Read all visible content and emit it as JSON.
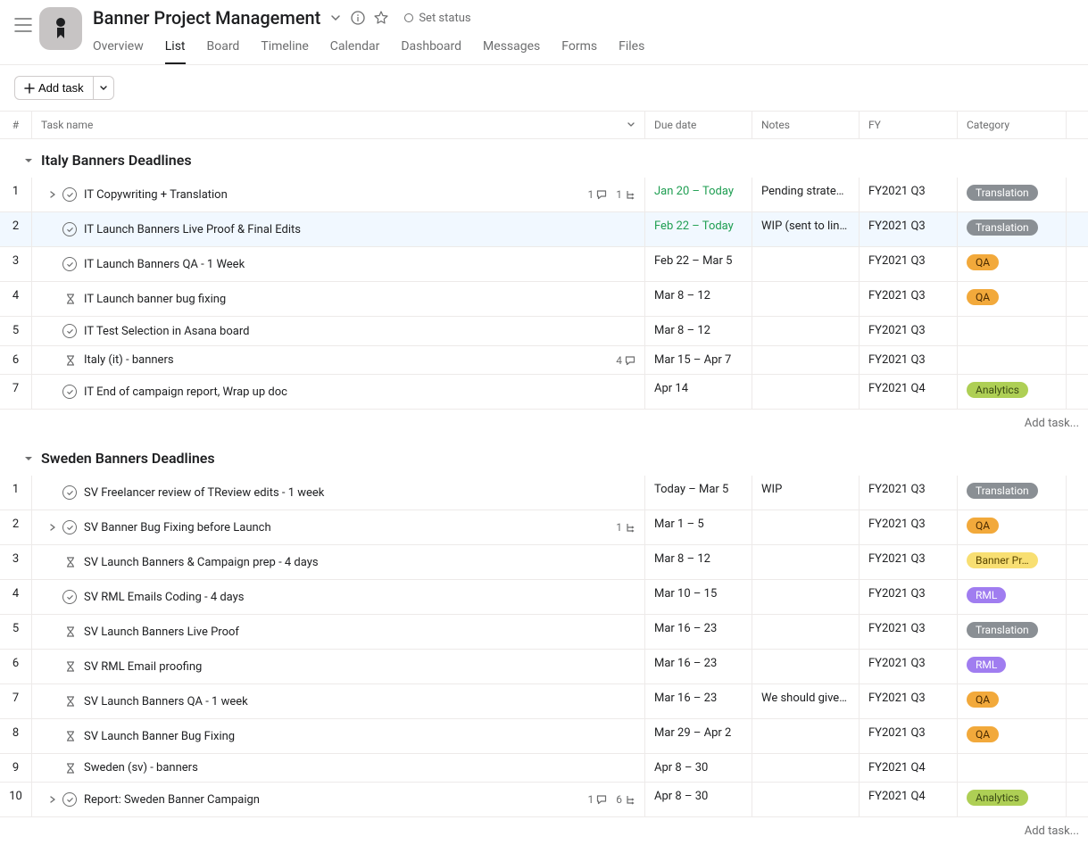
{
  "header": {
    "title": "Banner Project Management",
    "status_label": "Set status"
  },
  "tabs": [
    "Overview",
    "List",
    "Board",
    "Timeline",
    "Calendar",
    "Dashboard",
    "Messages",
    "Forms",
    "Files"
  ],
  "active_tab": "List",
  "toolbar": {
    "add_task": "Add task"
  },
  "columns": {
    "num": "#",
    "task": "Task name",
    "due": "Due date",
    "notes": "Notes",
    "fy": "FY",
    "category": "Category"
  },
  "add_task_placeholder": "Add task...",
  "sections": [
    {
      "title": "Italy Banners Deadlines",
      "rows": [
        {
          "n": 1,
          "icon": "check",
          "children": true,
          "name": "IT Copywriting + Translation",
          "comments": 1,
          "subtasks": 1,
          "due": "Jan 20 – Today",
          "due_color": "green",
          "notes": "Pending strategy …",
          "fy": "FY2021 Q3",
          "cat": "Translation",
          "cat_class": "translation"
        },
        {
          "n": 2,
          "icon": "check",
          "name": "IT Launch Banners Live Proof & Final Edits",
          "due": "Feb 22 – Today",
          "due_color": "green",
          "notes": "WIP (sent to lingu…",
          "fy": "FY2021 Q3",
          "cat": "Translation",
          "cat_class": "translation",
          "highlight": true
        },
        {
          "n": 3,
          "icon": "check",
          "name": "IT Launch Banners QA - 1 Week",
          "due": "Feb 22 – Mar 5",
          "fy": "FY2021 Q3",
          "cat": "QA",
          "cat_class": "qa"
        },
        {
          "n": 4,
          "icon": "hourglass",
          "name": "IT Launch banner bug fixing",
          "due": "Mar 8 – 12",
          "fy": "FY2021 Q3",
          "cat": "QA",
          "cat_class": "qa"
        },
        {
          "n": 5,
          "icon": "check",
          "name": "IT Test Selection in Asana board",
          "due": "Mar 8 – 12",
          "fy": "FY2021 Q3"
        },
        {
          "n": 6,
          "icon": "hourglass",
          "name": "Italy (it) - banners",
          "comments": 4,
          "due": "Mar 15 – Apr 7",
          "fy": "FY2021 Q3"
        },
        {
          "n": 7,
          "icon": "check",
          "name": "IT End of campaign report, Wrap up doc",
          "due": "Apr 14",
          "fy": "FY2021 Q4",
          "cat": "Analytics",
          "cat_class": "analytics"
        }
      ]
    },
    {
      "title": "Sweden Banners Deadlines",
      "rows": [
        {
          "n": 1,
          "icon": "check",
          "name": "SV Freelancer review of TReview edits - 1 week",
          "due": "Today – Mar 5",
          "notes": "WIP",
          "fy": "FY2021 Q3",
          "cat": "Translation",
          "cat_class": "translation"
        },
        {
          "n": 2,
          "icon": "check",
          "children": true,
          "name": "SV Banner Bug Fixing before Launch",
          "subtasks": 1,
          "due": "Mar 1 – 5",
          "fy": "FY2021 Q3",
          "cat": "QA",
          "cat_class": "qa"
        },
        {
          "n": 3,
          "icon": "hourglass",
          "name": "SV Launch Banners & Campaign prep - 4 days",
          "due": "Mar 8 – 12",
          "fy": "FY2021 Q3",
          "cat": "Banner Pr…",
          "cat_class": "bannerpr"
        },
        {
          "n": 4,
          "icon": "check",
          "name": "SV RML Emails Coding - 4 days",
          "due": "Mar 10 – 15",
          "fy": "FY2021 Q3",
          "cat": "RML",
          "cat_class": "rml"
        },
        {
          "n": 5,
          "icon": "hourglass",
          "name": "SV Launch Banners Live Proof",
          "due": "Mar 16 – 23",
          "fy": "FY2021 Q3",
          "cat": "Translation",
          "cat_class": "translation"
        },
        {
          "n": 6,
          "icon": "hourglass",
          "name": "SV RML Email proofing",
          "due": "Mar 16 – 23",
          "fy": "FY2021 Q3",
          "cat": "RML",
          "cat_class": "rml"
        },
        {
          "n": 7,
          "icon": "hourglass",
          "name": "SV Launch Banners QA - 1 week",
          "due": "Mar 16 – 23",
          "notes": "We should give J…",
          "fy": "FY2021 Q3",
          "cat": "QA",
          "cat_class": "qa"
        },
        {
          "n": 8,
          "icon": "hourglass",
          "name": "SV Launch Banner Bug Fixing",
          "due": "Mar 29 – Apr 2",
          "fy": "FY2021 Q3",
          "cat": "QA",
          "cat_class": "qa"
        },
        {
          "n": 9,
          "icon": "hourglass",
          "name": "Sweden (sv) - banners",
          "due": "Apr 8 – 30",
          "fy": "FY2021 Q4"
        },
        {
          "n": 10,
          "icon": "check",
          "children": true,
          "name": "Report: Sweden Banner Campaign",
          "comments": 1,
          "subtasks": 6,
          "due": "Apr 8 – 30",
          "fy": "FY2021 Q4",
          "cat": "Analytics",
          "cat_class": "analytics"
        }
      ]
    }
  ]
}
